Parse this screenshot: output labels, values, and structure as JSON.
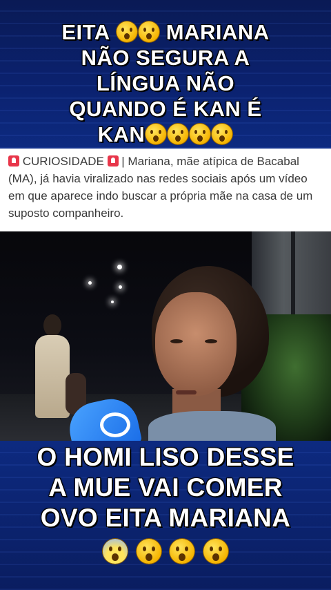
{
  "top_caption": {
    "line1": "EITA",
    "line1b": "MARIANA",
    "line2": "NÃO SEGURA A",
    "line3": "LÍNGUA NÃO",
    "line4": "QUANDO É KAN É",
    "line5": "KAN"
  },
  "news_card": {
    "tag": "CURIOSIDADE",
    "text_after_tag": " | Mariana, mãe atípica de Bacabal (MA), já havia viralizado nas redes sociais após um vídeo em que aparece indo buscar a própria mãe na casa de um suposto companheiro."
  },
  "bottom_caption": {
    "line1": "O HOMI LISO DESSE",
    "line2": "A MUE VAI COMER",
    "line3": "OVO EITA MARIANA"
  },
  "icons": {
    "emoji_surprised": "astonished-face-icon",
    "emoji_scream": "screaming-face-icon",
    "tag_icon": "siren-icon"
  },
  "colors": {
    "banner_blue": "#0b2270",
    "caption_text": "#ffffff",
    "siren_red": "#e8364a"
  }
}
